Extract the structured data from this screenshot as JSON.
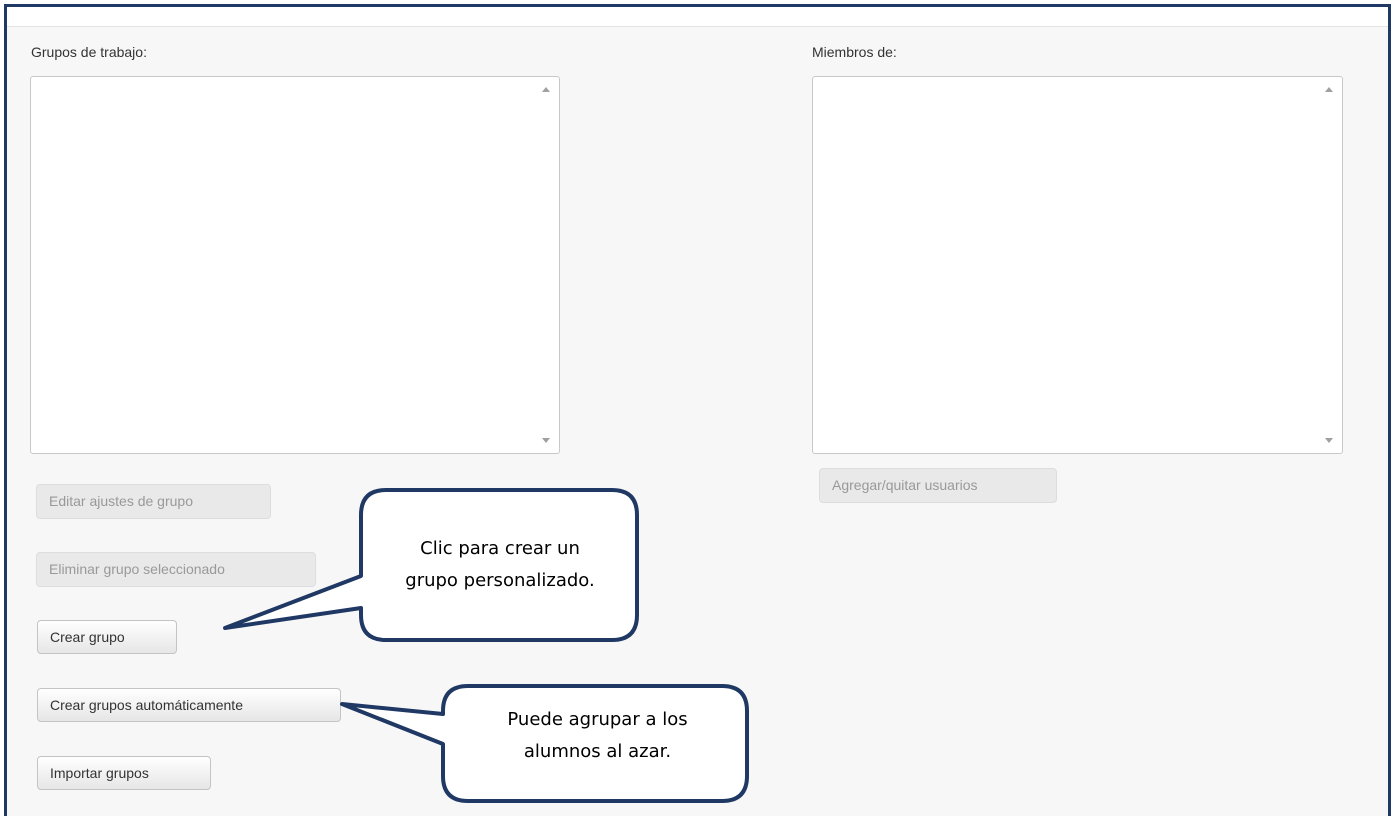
{
  "groups_panel": {
    "label": "Grupos de trabajo:",
    "buttons": {
      "edit": "Editar ajustes de grupo",
      "delete": "Eliminar grupo seleccionado",
      "create": "Crear grupo",
      "auto_create": "Crear grupos automáticamente",
      "import": "Importar grupos"
    }
  },
  "members_panel": {
    "label": "Miembros de:",
    "buttons": {
      "add_remove": "Agregar/quitar usuarios"
    }
  },
  "callouts": {
    "create_group": {
      "line1": "Clic para crear un",
      "line2": "grupo personalizado."
    },
    "auto_group": {
      "line1": "Puede agrupar a los",
      "line2": "alumnos al azar."
    }
  },
  "colors": {
    "frame_border": "#1f3864",
    "callout_border": "#1f3864",
    "panel_background": "#f7f7f7"
  }
}
